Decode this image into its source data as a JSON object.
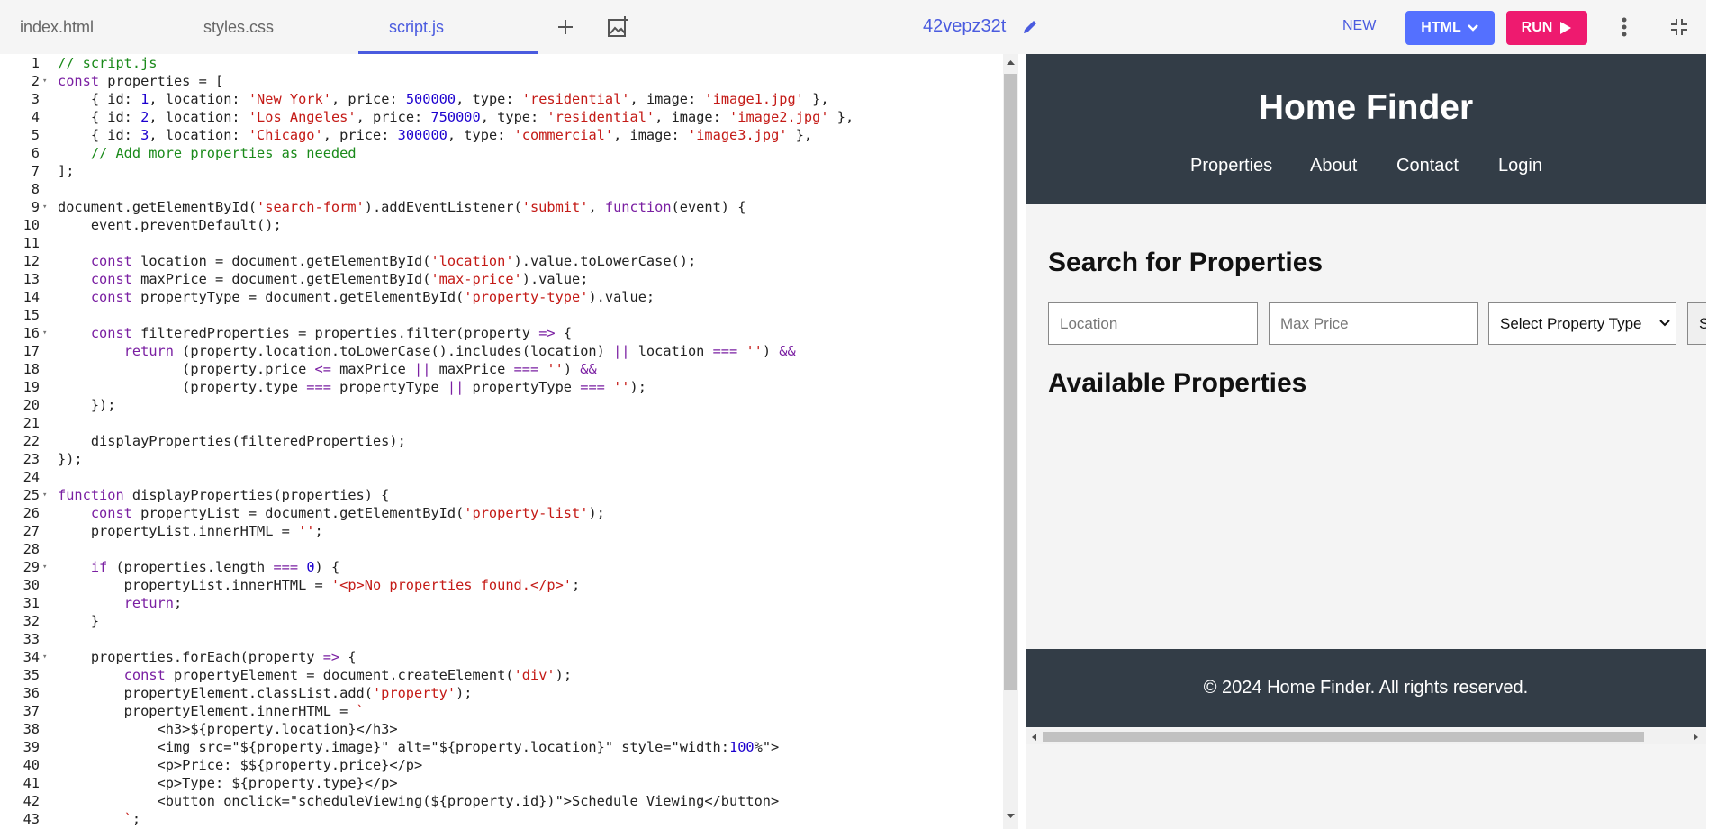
{
  "tabs": {
    "html": "index.html",
    "css": "styles.css",
    "js": "script.js"
  },
  "project": {
    "title": "42vepz32t"
  },
  "toolbar": {
    "new": "NEW",
    "html": "HTML",
    "run": "RUN"
  },
  "code_lines": [
    {
      "n": "1",
      "t": "// script.js"
    },
    {
      "n": "2",
      "t": "const properties = ["
    },
    {
      "n": "3",
      "t": "    { id: 1, location: 'New York', price: 500000, type: 'residential', image: 'image1.jpg' },"
    },
    {
      "n": "4",
      "t": "    { id: 2, location: 'Los Angeles', price: 750000, type: 'residential', image: 'image2.jpg' },"
    },
    {
      "n": "5",
      "t": "    { id: 3, location: 'Chicago', price: 300000, type: 'commercial', image: 'image3.jpg' },"
    },
    {
      "n": "6",
      "t": "    // Add more properties as needed"
    },
    {
      "n": "7",
      "t": "];"
    },
    {
      "n": "8",
      "t": ""
    },
    {
      "n": "9",
      "t": "document.getElementById('search-form').addEventListener('submit', function(event) {"
    },
    {
      "n": "10",
      "t": "    event.preventDefault();"
    },
    {
      "n": "11",
      "t": ""
    },
    {
      "n": "12",
      "t": "    const location = document.getElementById('location').value.toLowerCase();"
    },
    {
      "n": "13",
      "t": "    const maxPrice = document.getElementById('max-price').value;"
    },
    {
      "n": "14",
      "t": "    const propertyType = document.getElementById('property-type').value;"
    },
    {
      "n": "15",
      "t": ""
    },
    {
      "n": "16",
      "t": "    const filteredProperties = properties.filter(property => {"
    },
    {
      "n": "17",
      "t": "        return (property.location.toLowerCase().includes(location) || location === '') &&"
    },
    {
      "n": "18",
      "t": "               (property.price <= maxPrice || maxPrice === '') &&"
    },
    {
      "n": "19",
      "t": "               (property.type === propertyType || propertyType === '');"
    },
    {
      "n": "20",
      "t": "    });"
    },
    {
      "n": "21",
      "t": ""
    },
    {
      "n": "22",
      "t": "    displayProperties(filteredProperties);"
    },
    {
      "n": "23",
      "t": "});"
    },
    {
      "n": "24",
      "t": ""
    },
    {
      "n": "25",
      "t": "function displayProperties(properties) {"
    },
    {
      "n": "26",
      "t": "    const propertyList = document.getElementById('property-list');"
    },
    {
      "n": "27",
      "t": "    propertyList.innerHTML = '';"
    },
    {
      "n": "28",
      "t": ""
    },
    {
      "n": "29",
      "t": "    if (properties.length === 0) {"
    },
    {
      "n": "30",
      "t": "        propertyList.innerHTML = '<p>No properties found.</p>';"
    },
    {
      "n": "31",
      "t": "        return;"
    },
    {
      "n": "32",
      "t": "    }"
    },
    {
      "n": "33",
      "t": ""
    },
    {
      "n": "34",
      "t": "    properties.forEach(property => {"
    },
    {
      "n": "35",
      "t": "        const propertyElement = document.createElement('div');"
    },
    {
      "n": "36",
      "t": "        propertyElement.classList.add('property');"
    },
    {
      "n": "37",
      "t": "        propertyElement.innerHTML = `"
    },
    {
      "n": "38",
      "t": "            <h3>${property.location}</h3>"
    },
    {
      "n": "39",
      "t": "            <img src=\"${property.image}\" alt=\"${property.location}\" style=\"width:100%\">"
    },
    {
      "n": "40",
      "t": "            <p>Price: $${property.price}</p>"
    },
    {
      "n": "41",
      "t": "            <p>Type: ${property.type}</p>"
    },
    {
      "n": "42",
      "t": "            <button onclick=\"scheduleViewing(${property.id})\">Schedule Viewing</button>"
    },
    {
      "n": "43",
      "t": "        `;"
    }
  ],
  "fold_lines": [
    "2",
    "9",
    "16",
    "25",
    "29",
    "34"
  ],
  "preview": {
    "site_title": "Home Finder",
    "nav": [
      "Properties",
      "About",
      "Contact",
      "Login"
    ],
    "search_heading": "Search for Properties",
    "location_placeholder": "Location",
    "max_price_placeholder": "Max Price",
    "property_type_select": "Select Property Type",
    "search_button_partial": "S",
    "available_heading": "Available Properties",
    "footer": "© 2024 Home Finder. All rights reserved."
  },
  "icons": {
    "add_tab": "plus-icon",
    "add_image": "add-image-icon",
    "edit_title": "pencil-icon",
    "html_dropdown": "chevron-down-icon",
    "run": "play-icon",
    "more": "more-vertical-icon",
    "collapse": "collapse-icon"
  },
  "colors": {
    "accent": "#4a5bdf",
    "run": "#ee1a6f",
    "html_button": "#5470ff",
    "preview_header": "#333d47"
  }
}
